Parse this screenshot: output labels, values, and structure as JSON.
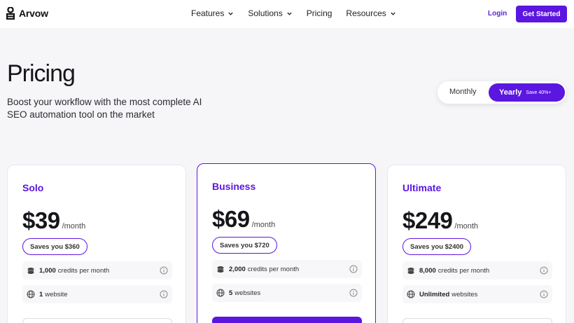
{
  "brand": {
    "name": "Arvow"
  },
  "nav": {
    "links": [
      {
        "label": "Features",
        "dropdown": true
      },
      {
        "label": "Solutions",
        "dropdown": true
      },
      {
        "label": "Pricing",
        "dropdown": false
      },
      {
        "label": "Resources",
        "dropdown": true
      }
    ],
    "login": "Login",
    "cta": "Get Started"
  },
  "hero": {
    "title": "Pricing",
    "subtitle": "Boost your workflow with the most complete AI SEO automation tool on the market"
  },
  "billing_toggle": {
    "monthly": "Monthly",
    "yearly": "Yearly",
    "yearly_badge": "Save 40%+",
    "selected": "Yearly"
  },
  "plans": [
    {
      "name": "Solo",
      "price": "$39",
      "period": "/month",
      "savings": "Saves you $360",
      "credits_value": "1,000",
      "credits_label": "credits per month",
      "websites_value": "1",
      "websites_label": "website",
      "highlighted": false
    },
    {
      "name": "Business",
      "price": "$69",
      "period": "/month",
      "savings": "Saves you $720",
      "credits_value": "2,000",
      "credits_label": "credits per month",
      "websites_value": "5",
      "websites_label": "websites",
      "highlighted": true
    },
    {
      "name": "Ultimate",
      "price": "$249",
      "period": "/month",
      "savings": "Saves you $2400",
      "credits_value": "8,000",
      "credits_label": "credits per month",
      "websites_value": "Unlimited",
      "websites_label": "websites",
      "highlighted": false
    }
  ],
  "colors": {
    "accent": "#5b16e0",
    "background": "#f6f6f8",
    "card": "#ffffff"
  },
  "icons": {
    "dropdown": "chevron-down-icon",
    "credits": "coins-icon",
    "websites": "globe-icon",
    "info": "info-icon"
  }
}
